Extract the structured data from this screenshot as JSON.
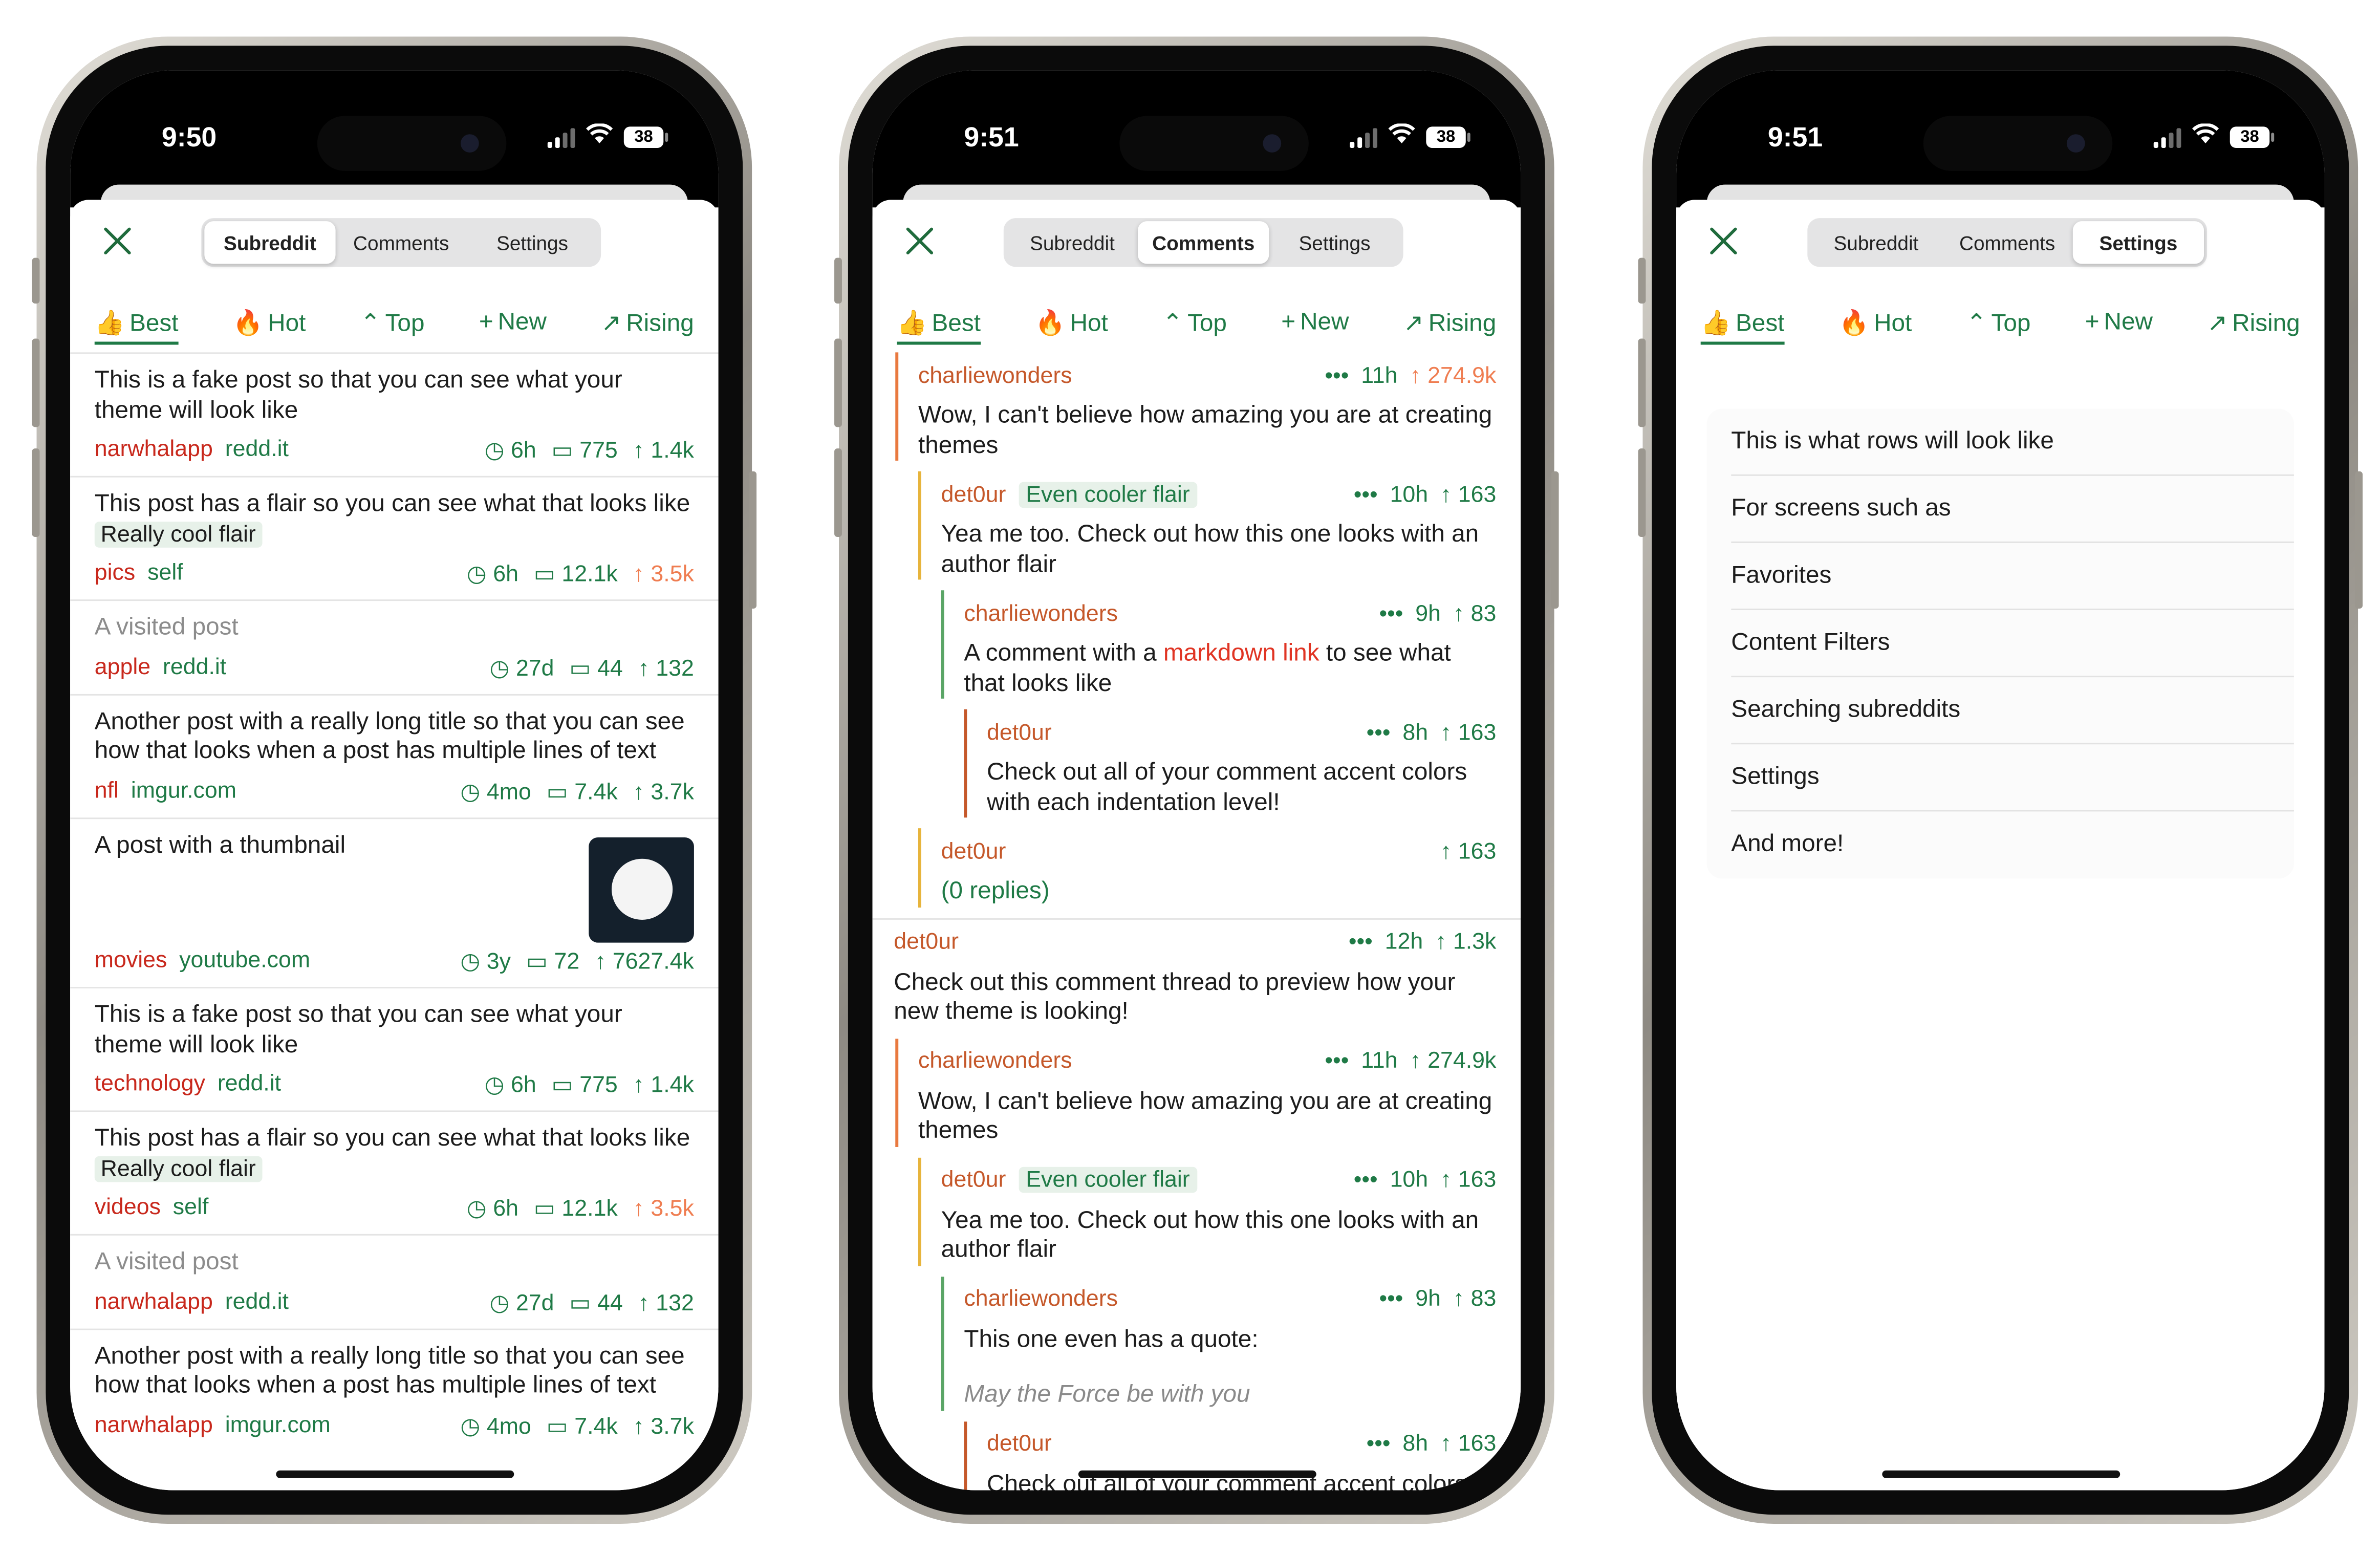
{
  "colors": {
    "accent": "#1f7a46",
    "subreddit": "#c8281c",
    "author": "#c5582a",
    "hot_score": "#ef7d51",
    "link": "#e03423"
  },
  "tabs": [
    "Subreddit",
    "Comments",
    "Settings"
  ],
  "sorts": [
    {
      "icon": "thumbs-up-icon",
      "glyph": "👍",
      "label": "Best"
    },
    {
      "icon": "flame-icon",
      "glyph": "🔥",
      "label": "Hot"
    },
    {
      "icon": "chevron-up-icon",
      "glyph": "⌃",
      "label": "Top"
    },
    {
      "icon": "plus-icon",
      "glyph": "+",
      "label": "New"
    },
    {
      "icon": "arrow-up-right-icon",
      "glyph": "↗",
      "label": "Rising"
    }
  ],
  "phones": [
    {
      "time": "9:50",
      "battery": "38",
      "selected_tab": 0
    },
    {
      "time": "9:51",
      "battery": "38",
      "selected_tab": 1
    },
    {
      "time": "9:51",
      "battery": "38",
      "selected_tab": 2
    }
  ],
  "posts": [
    {
      "title": "This is a fake post so that you can see what your theme will look like",
      "subreddit": "narwhalapp",
      "domain": "redd.it",
      "age": "6h",
      "comments": "775",
      "score": "1.4k",
      "hot": false,
      "visited": false
    },
    {
      "title": "This post has a flair so you can see what that looks like",
      "flair": "Really cool flair",
      "subreddit": "pics",
      "domain": "self",
      "age": "6h",
      "comments": "12.1k",
      "score": "3.5k",
      "hot": true,
      "visited": false
    },
    {
      "title": "A visited post",
      "subreddit": "apple",
      "domain": "redd.it",
      "age": "27d",
      "comments": "44",
      "score": "132",
      "hot": false,
      "visited": true
    },
    {
      "title": "Another post with a really long title so that you can see how that looks when a post has multiple lines of text",
      "subreddit": "nfl",
      "domain": "imgur.com",
      "age": "4mo",
      "comments": "7.4k",
      "score": "3.7k",
      "hot": false,
      "visited": false
    },
    {
      "title": "A post with a thumbnail",
      "thumbnail": true,
      "subreddit": "movies",
      "domain": "youtube.com",
      "age": "3y",
      "comments": "72",
      "score": "7627.4k",
      "hot": false,
      "visited": false
    },
    {
      "title": "This is a fake post so that you can see what your theme will look like",
      "subreddit": "technology",
      "domain": "redd.it",
      "age": "6h",
      "comments": "775",
      "score": "1.4k",
      "hot": false,
      "visited": false
    },
    {
      "title": "This post has a flair so you can see what that looks like",
      "flair": "Really cool flair",
      "subreddit": "videos",
      "domain": "self",
      "age": "6h",
      "comments": "12.1k",
      "score": "3.5k",
      "hot": true,
      "visited": false
    },
    {
      "title": "A visited post",
      "subreddit": "narwhalapp",
      "domain": "redd.it",
      "age": "27d",
      "comments": "44",
      "score": "132",
      "hot": false,
      "visited": true
    },
    {
      "title": "Another post with a really long title so that you can see how that looks when a post has multiple lines of text",
      "subreddit": "narwhalapp",
      "domain": "imgur.com",
      "age": "4mo",
      "comments": "7.4k",
      "score": "3.7k",
      "hot": false,
      "visited": false
    }
  ],
  "comments": [
    {
      "depth": 1,
      "author": "charliewonders",
      "age": "11h",
      "score": "274.9k",
      "hot": true,
      "more": true,
      "body": "Wow, I can't believe how amazing you are at creating themes",
      "bar": "#e9793f"
    },
    {
      "depth": 2,
      "author": "det0ur",
      "flair": "Even cooler flair",
      "age": "10h",
      "score": "163",
      "more": true,
      "body": "Yea me too. Check out how this one looks with an author flair",
      "bar": "#e7b43c"
    },
    {
      "depth": 3,
      "author": "charliewonders",
      "age": "9h",
      "score": "83",
      "more": true,
      "body_parts": [
        "A comment with a ",
        "markdown link",
        " to see what that looks like"
      ],
      "bar": "#5aa566"
    },
    {
      "depth": 4,
      "author": "det0ur",
      "age": "8h",
      "score": "163",
      "more": true,
      "body": "Check out all of your comment accent colors with each indentation level!",
      "bar": "#c5582a"
    },
    {
      "depth": 2,
      "author": "det0ur",
      "score": "163",
      "more": false,
      "body": "(0 replies)",
      "replies": true,
      "bar": "#e7b43c"
    },
    {
      "depth": 0,
      "author": "det0ur",
      "age": "12h",
      "score": "1.3k",
      "more": true,
      "body": "Check out this comment thread to preview how your new theme is looking!",
      "top_border": true
    },
    {
      "depth": 1,
      "author": "charliewonders",
      "age": "11h",
      "score": "274.9k",
      "more": true,
      "body": "Wow, I can't believe how amazing you are at creating themes",
      "bar": "#e9793f"
    },
    {
      "depth": 2,
      "author": "det0ur",
      "flair": "Even cooler flair",
      "age": "10h",
      "score": "163",
      "more": true,
      "body": "Yea me too. Check out how this one looks with an author flair",
      "bar": "#e7b43c"
    },
    {
      "depth": 3,
      "author": "charliewonders",
      "age": "9h",
      "score": "83",
      "more": true,
      "body": "This one even has a quote:",
      "quote": "May the Force be with you",
      "bar": "#5aa566"
    },
    {
      "depth": 4,
      "author": "det0ur",
      "age": "8h",
      "score": "163",
      "more": true,
      "body": "Check out all of your comment accent colors with each indentation level!",
      "bar": "#c5582a"
    }
  ],
  "settings_rows": [
    "This is what rows will look like",
    "For screens such as",
    "Favorites",
    "Content Filters",
    "Searching subreddits",
    "Settings",
    "And more!"
  ]
}
